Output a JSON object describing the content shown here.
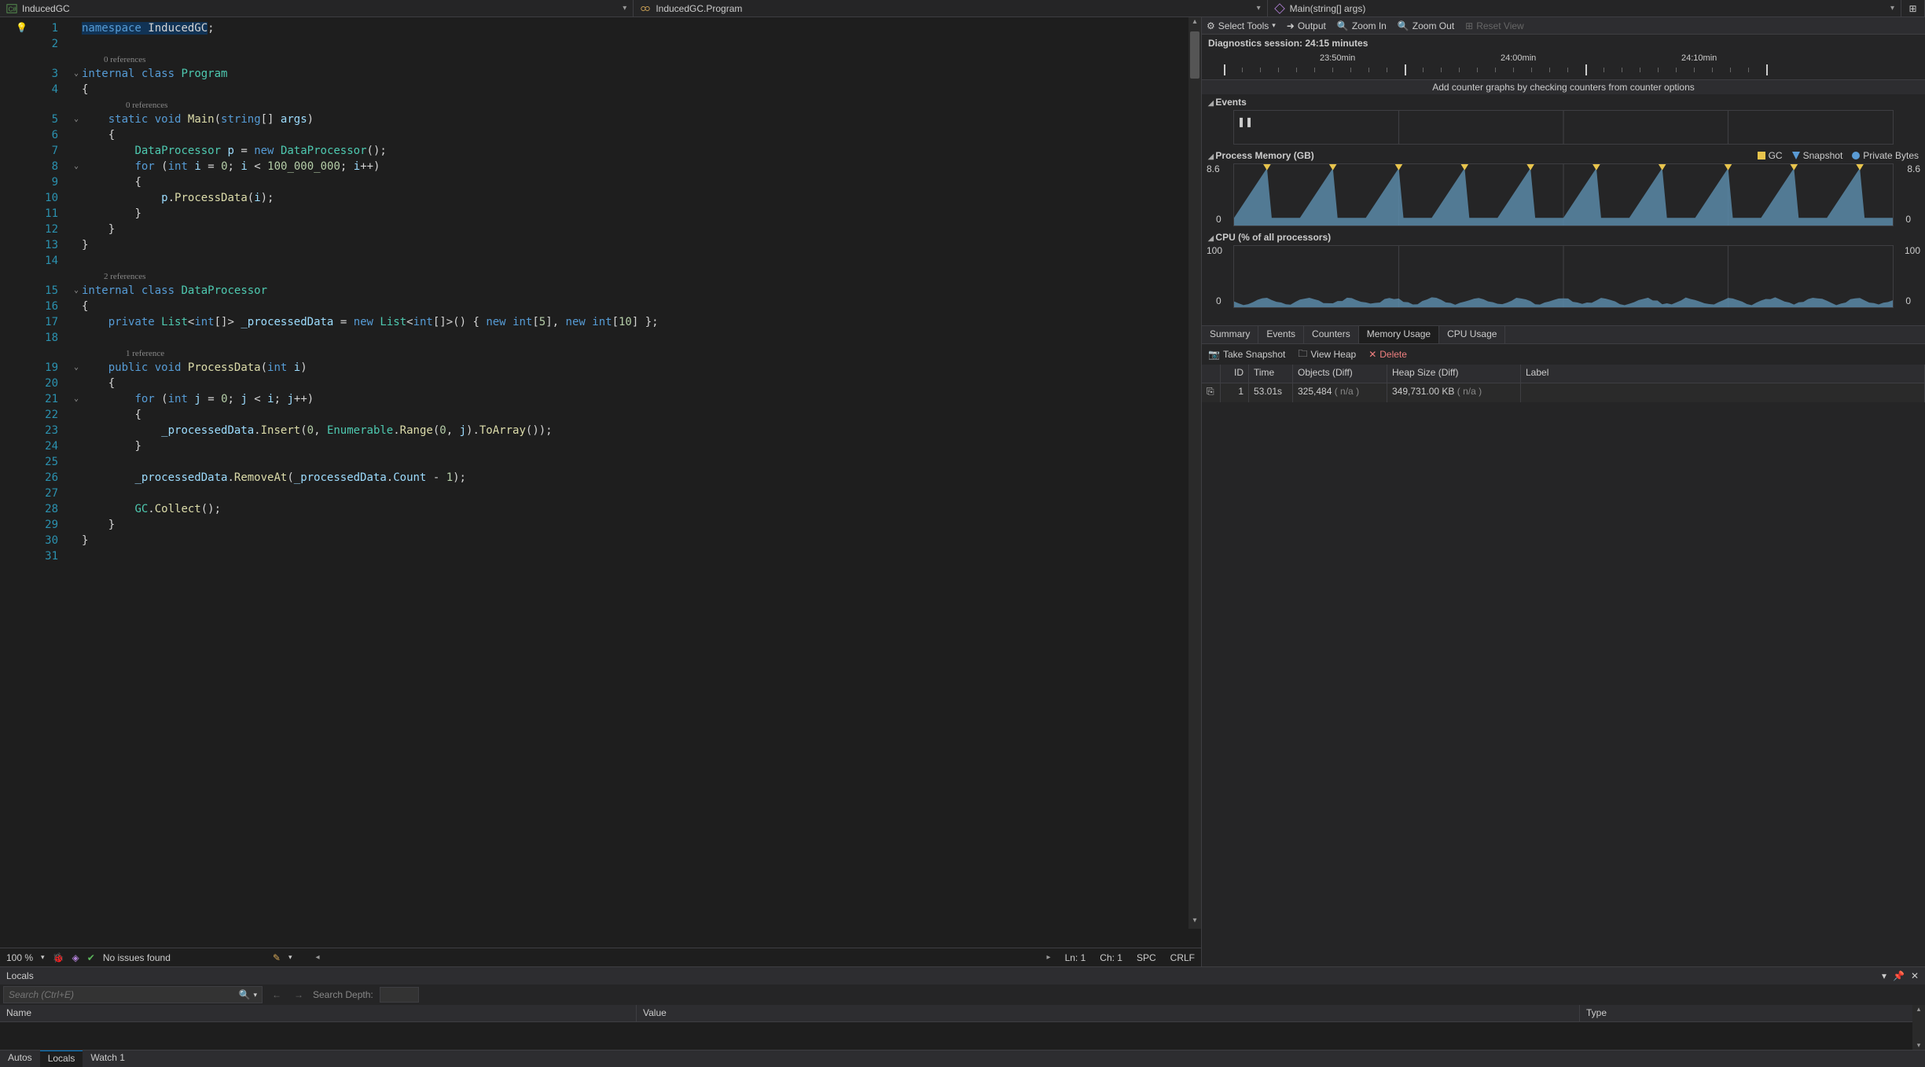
{
  "nav": {
    "project": "InducedGC",
    "class": "InducedGC.Program",
    "method": "Main(string[] args)"
  },
  "code": {
    "lines": [
      {
        "n": 1,
        "fold": "",
        "lens": "",
        "html": "<span class='highlight-ns'><span class='kw'>namespace</span> <span class='ns'>InducedGC</span></span><span class='punct'>;</span>"
      },
      {
        "n": 2,
        "fold": "",
        "lens": "",
        "html": ""
      },
      {
        "lens": "0 references",
        "indent": 1
      },
      {
        "n": 3,
        "fold": "⌄",
        "lens": "",
        "html": "<span class='kw'>internal</span> <span class='kw'>class</span> <span class='type'>Program</span>"
      },
      {
        "n": 4,
        "fold": "",
        "lens": "",
        "html": "<span class='punct'>{</span>"
      },
      {
        "lens": "0 references",
        "indent": 2
      },
      {
        "n": 5,
        "fold": "⌄",
        "lens": "",
        "html": "    <span class='kw'>static</span> <span class='kw'>void</span> <span class='method'>Main</span><span class='punct'>(</span><span class='kw'>string</span><span class='punct'>[]</span> <span class='ident'>args</span><span class='punct'>)</span>"
      },
      {
        "n": 6,
        "fold": "",
        "lens": "",
        "html": "    <span class='punct'>{</span>"
      },
      {
        "n": 7,
        "fold": "",
        "lens": "",
        "html": "        <span class='type'>DataProcessor</span> <span class='ident'>p</span> <span class='punct'>=</span> <span class='kw'>new</span> <span class='type'>DataProcessor</span><span class='punct'>();</span>"
      },
      {
        "n": 8,
        "fold": "⌄",
        "lens": "",
        "html": "        <span class='kw'>for</span> <span class='punct'>(</span><span class='kw'>int</span> <span class='ident'>i</span> <span class='punct'>=</span> <span class='num'>0</span><span class='punct'>;</span> <span class='ident'>i</span> <span class='punct'>&lt;</span> <span class='num'>100_000_000</span><span class='punct'>;</span> <span class='ident'>i</span><span class='punct'>++)</span>"
      },
      {
        "n": 9,
        "fold": "",
        "lens": "",
        "html": "        <span class='punct'>{</span>"
      },
      {
        "n": 10,
        "fold": "",
        "lens": "",
        "html": "            <span class='ident'>p</span><span class='punct'>.</span><span class='method'>ProcessData</span><span class='punct'>(</span><span class='ident'>i</span><span class='punct'>);</span>"
      },
      {
        "n": 11,
        "fold": "",
        "lens": "",
        "html": "        <span class='punct'>}</span>"
      },
      {
        "n": 12,
        "fold": "",
        "lens": "",
        "html": "    <span class='punct'>}</span>"
      },
      {
        "n": 13,
        "fold": "",
        "lens": "",
        "html": "<span class='punct'>}</span>"
      },
      {
        "n": 14,
        "fold": "",
        "lens": "",
        "html": ""
      },
      {
        "lens": "2 references",
        "indent": 1
      },
      {
        "n": 15,
        "fold": "⌄",
        "lens": "",
        "html": "<span class='kw'>internal</span> <span class='kw'>class</span> <span class='type'>DataProcessor</span>"
      },
      {
        "n": 16,
        "fold": "",
        "lens": "",
        "html": "<span class='punct'>{</span>"
      },
      {
        "n": 17,
        "fold": "",
        "lens": "",
        "html": "    <span class='kw'>private</span> <span class='type'>List</span><span class='punct'>&lt;</span><span class='kw'>int</span><span class='punct'>[]&gt;</span> <span class='ident'>_processedData</span> <span class='punct'>=</span> <span class='kw'>new</span> <span class='type'>List</span><span class='punct'>&lt;</span><span class='kw'>int</span><span class='punct'>[]&gt;() {</span> <span class='kw'>new</span> <span class='kw'>int</span><span class='punct'>[</span><span class='num'>5</span><span class='punct'>],</span> <span class='kw'>new</span> <span class='kw'>int</span><span class='punct'>[</span><span class='num'>10</span><span class='punct'>] };</span>"
      },
      {
        "n": 18,
        "fold": "",
        "lens": "",
        "html": ""
      },
      {
        "lens": "1 reference",
        "indent": 2
      },
      {
        "n": 19,
        "fold": "⌄",
        "lens": "",
        "html": "    <span class='kw'>public</span> <span class='kw'>void</span> <span class='method'>ProcessData</span><span class='punct'>(</span><span class='kw'>int</span> <span class='ident'>i</span><span class='punct'>)</span>"
      },
      {
        "n": 20,
        "fold": "",
        "lens": "",
        "html": "    <span class='punct'>{</span>"
      },
      {
        "n": 21,
        "fold": "⌄",
        "lens": "",
        "html": "        <span class='kw'>for</span> <span class='punct'>(</span><span class='kw'>int</span> <span class='ident'>j</span> <span class='punct'>=</span> <span class='num'>0</span><span class='punct'>;</span> <span class='ident'>j</span> <span class='punct'>&lt;</span> <span class='ident'>i</span><span class='punct'>;</span> <span class='ident'>j</span><span class='punct'>++)</span>"
      },
      {
        "n": 22,
        "fold": "",
        "lens": "",
        "html": "        <span class='punct'>{</span>"
      },
      {
        "n": 23,
        "fold": "",
        "lens": "",
        "html": "            <span class='ident'>_processedData</span><span class='punct'>.</span><span class='method'>Insert</span><span class='punct'>(</span><span class='num'>0</span><span class='punct'>,</span> <span class='type'>Enumerable</span><span class='punct'>.</span><span class='method'>Range</span><span class='punct'>(</span><span class='num'>0</span><span class='punct'>,</span> <span class='ident'>j</span><span class='punct'>).</span><span class='method'>ToArray</span><span class='punct'>());</span>"
      },
      {
        "n": 24,
        "fold": "",
        "lens": "",
        "html": "        <span class='punct'>}</span>"
      },
      {
        "n": 25,
        "fold": "",
        "lens": "",
        "html": ""
      },
      {
        "n": 26,
        "fold": "",
        "lens": "",
        "html": "        <span class='ident'>_processedData</span><span class='punct'>.</span><span class='method'>RemoveAt</span><span class='punct'>(</span><span class='ident'>_processedData</span><span class='punct'>.</span><span class='ident'>Count</span> <span class='punct'>-</span> <span class='num'>1</span><span class='punct'>);</span>"
      },
      {
        "n": 27,
        "fold": "",
        "lens": "",
        "html": ""
      },
      {
        "n": 28,
        "fold": "",
        "lens": "",
        "html": "        <span class='type'>GC</span><span class='punct'>.</span><span class='method'>Collect</span><span class='punct'>();</span>"
      },
      {
        "n": 29,
        "fold": "",
        "lens": "",
        "html": "    <span class='punct'>}</span>"
      },
      {
        "n": 30,
        "fold": "",
        "lens": "",
        "html": "<span class='punct'>}</span>"
      },
      {
        "n": 31,
        "fold": "",
        "lens": "",
        "html": ""
      }
    ]
  },
  "status": {
    "zoom": "100 %",
    "issues": "No issues found",
    "ln": "Ln: 1",
    "ch": "Ch: 1",
    "spc": "SPC",
    "crlf": "CRLF"
  },
  "diag": {
    "toolbar": {
      "select_tools": "Select Tools",
      "output": "Output",
      "zoom_in": "Zoom In",
      "zoom_out": "Zoom Out",
      "reset_view": "Reset View"
    },
    "session": "Diagnostics session: 24:15 minutes",
    "ruler_labels": [
      "23:50min",
      "24:00min",
      "24:10min"
    ],
    "counter_hint": "Add counter graphs by checking counters from counter options",
    "sections": {
      "events": "Events",
      "memory": "Process Memory (GB)",
      "cpu": "CPU (% of all processors)"
    },
    "legend": {
      "gc": "GC",
      "snapshot": "Snapshot",
      "private_bytes": "Private Bytes"
    },
    "mem_y": {
      "top": "8.6",
      "bot": "0"
    },
    "cpu_y": {
      "top": "100",
      "bot": "0"
    },
    "tabs": [
      "Summary",
      "Events",
      "Counters",
      "Memory Usage",
      "CPU Usage"
    ],
    "active_tab": 3,
    "actions": {
      "take_snapshot": "Take Snapshot",
      "view_heap": "View Heap",
      "delete": "Delete"
    },
    "snap_cols": [
      "ID",
      "Time",
      "Objects (Diff)",
      "Heap Size (Diff)",
      "Label"
    ],
    "snap_rows": [
      {
        "id": "1",
        "time": "53.01s",
        "objects": "325,484",
        "objects_diff": "( n/a )",
        "heap": "349,731.00 KB",
        "heap_diff": "( n/a )",
        "label": ""
      }
    ]
  },
  "locals": {
    "title": "Locals",
    "search_placeholder": "Search (Ctrl+E)",
    "depth_label": "Search Depth:",
    "cols": [
      "Name",
      "Value",
      "Type"
    ],
    "tabs": [
      "Autos",
      "Locals",
      "Watch 1"
    ],
    "active_tab": 1
  }
}
